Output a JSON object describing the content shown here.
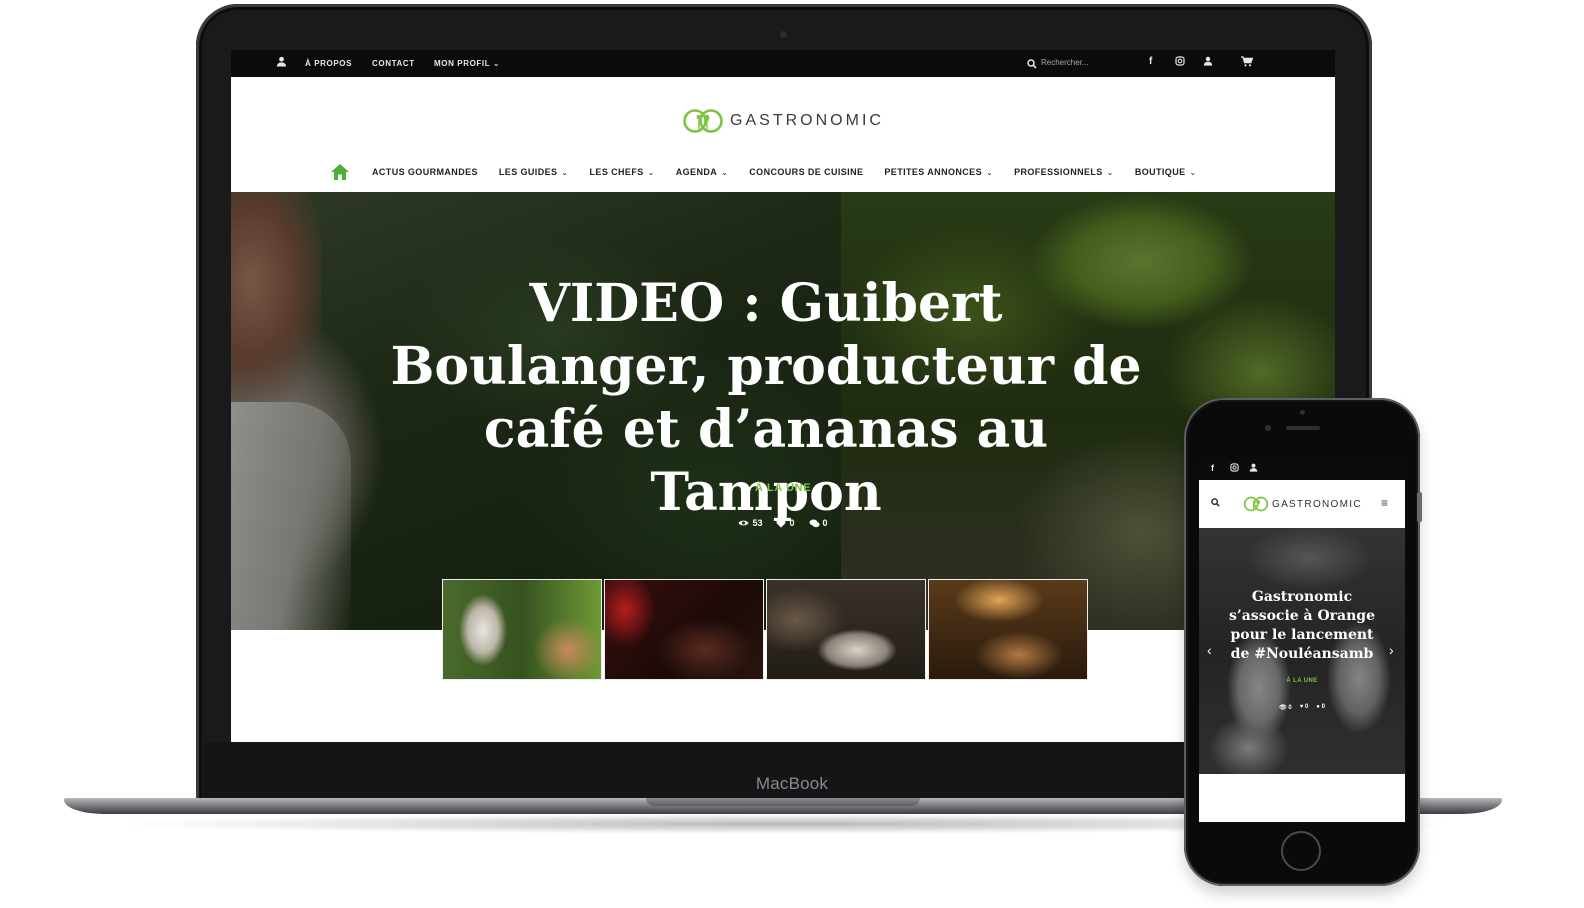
{
  "laptop": {
    "brand_label": "MacBook",
    "topbar": {
      "items": [
        {
          "label": "À PROPOS"
        },
        {
          "label": "CONTACT"
        },
        {
          "label": "MON PROFIL"
        }
      ],
      "search_placeholder": "Rechercher...",
      "icons": [
        "user-icon",
        "search-icon",
        "facebook-icon",
        "instagram-icon",
        "user-icon",
        "cart-icon"
      ]
    },
    "logo": {
      "text": "GASTRONOMIC",
      "color": "#7dc443"
    },
    "nav": {
      "items": [
        {
          "label": "ACTUS GOURMANDES",
          "dropdown": false
        },
        {
          "label": "LES GUIDES",
          "dropdown": true
        },
        {
          "label": "LES CHEFS",
          "dropdown": true
        },
        {
          "label": "AGENDA",
          "dropdown": true
        },
        {
          "label": "CONCOURS DE CUISINE",
          "dropdown": false
        },
        {
          "label": "PETITES ANNONCES",
          "dropdown": true
        },
        {
          "label": "PROFESSIONNELS",
          "dropdown": true
        },
        {
          "label": "BOUTIQUE",
          "dropdown": true
        }
      ],
      "home_icon_color": "#4caf3a"
    },
    "hero": {
      "title": "VIDEO : Guibert Boulanger, producteur de café et d’ananas au Tampon",
      "category": "À LA UNE",
      "views": "53",
      "likes": "0",
      "comments": "0"
    }
  },
  "phone": {
    "logo_text": "GASTRONOMIC",
    "hero": {
      "title": "Gastronomic s’associe à Orange pour le lancement de #Nouléansamb",
      "category": "À LA UNE",
      "views": "0",
      "likes": "0",
      "comments": "0"
    }
  },
  "colors": {
    "accent": "#7dc443",
    "topbar": "#0b0b0b"
  }
}
